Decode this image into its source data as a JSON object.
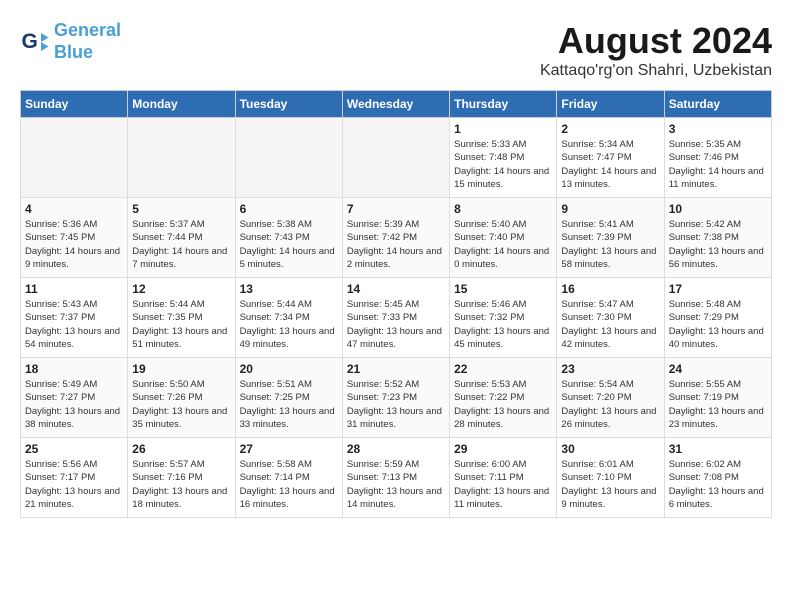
{
  "header": {
    "logo_line1": "General",
    "logo_line2": "Blue",
    "month_year": "August 2024",
    "location": "Kattaqo'rg'on Shahri, Uzbekistan"
  },
  "weekdays": [
    "Sunday",
    "Monday",
    "Tuesday",
    "Wednesday",
    "Thursday",
    "Friday",
    "Saturday"
  ],
  "weeks": [
    [
      {
        "day": "",
        "empty": true
      },
      {
        "day": "",
        "empty": true
      },
      {
        "day": "",
        "empty": true
      },
      {
        "day": "",
        "empty": true
      },
      {
        "day": "1",
        "sunrise": "5:33 AM",
        "sunset": "7:48 PM",
        "daylight": "14 hours and 15 minutes."
      },
      {
        "day": "2",
        "sunrise": "5:34 AM",
        "sunset": "7:47 PM",
        "daylight": "14 hours and 13 minutes."
      },
      {
        "day": "3",
        "sunrise": "5:35 AM",
        "sunset": "7:46 PM",
        "daylight": "14 hours and 11 minutes."
      }
    ],
    [
      {
        "day": "4",
        "sunrise": "5:36 AM",
        "sunset": "7:45 PM",
        "daylight": "14 hours and 9 minutes."
      },
      {
        "day": "5",
        "sunrise": "5:37 AM",
        "sunset": "7:44 PM",
        "daylight": "14 hours and 7 minutes."
      },
      {
        "day": "6",
        "sunrise": "5:38 AM",
        "sunset": "7:43 PM",
        "daylight": "14 hours and 5 minutes."
      },
      {
        "day": "7",
        "sunrise": "5:39 AM",
        "sunset": "7:42 PM",
        "daylight": "14 hours and 2 minutes."
      },
      {
        "day": "8",
        "sunrise": "5:40 AM",
        "sunset": "7:40 PM",
        "daylight": "14 hours and 0 minutes."
      },
      {
        "day": "9",
        "sunrise": "5:41 AM",
        "sunset": "7:39 PM",
        "daylight": "13 hours and 58 minutes."
      },
      {
        "day": "10",
        "sunrise": "5:42 AM",
        "sunset": "7:38 PM",
        "daylight": "13 hours and 56 minutes."
      }
    ],
    [
      {
        "day": "11",
        "sunrise": "5:43 AM",
        "sunset": "7:37 PM",
        "daylight": "13 hours and 54 minutes."
      },
      {
        "day": "12",
        "sunrise": "5:44 AM",
        "sunset": "7:35 PM",
        "daylight": "13 hours and 51 minutes."
      },
      {
        "day": "13",
        "sunrise": "5:44 AM",
        "sunset": "7:34 PM",
        "daylight": "13 hours and 49 minutes."
      },
      {
        "day": "14",
        "sunrise": "5:45 AM",
        "sunset": "7:33 PM",
        "daylight": "13 hours and 47 minutes."
      },
      {
        "day": "15",
        "sunrise": "5:46 AM",
        "sunset": "7:32 PM",
        "daylight": "13 hours and 45 minutes."
      },
      {
        "day": "16",
        "sunrise": "5:47 AM",
        "sunset": "7:30 PM",
        "daylight": "13 hours and 42 minutes."
      },
      {
        "day": "17",
        "sunrise": "5:48 AM",
        "sunset": "7:29 PM",
        "daylight": "13 hours and 40 minutes."
      }
    ],
    [
      {
        "day": "18",
        "sunrise": "5:49 AM",
        "sunset": "7:27 PM",
        "daylight": "13 hours and 38 minutes."
      },
      {
        "day": "19",
        "sunrise": "5:50 AM",
        "sunset": "7:26 PM",
        "daylight": "13 hours and 35 minutes."
      },
      {
        "day": "20",
        "sunrise": "5:51 AM",
        "sunset": "7:25 PM",
        "daylight": "13 hours and 33 minutes."
      },
      {
        "day": "21",
        "sunrise": "5:52 AM",
        "sunset": "7:23 PM",
        "daylight": "13 hours and 31 minutes."
      },
      {
        "day": "22",
        "sunrise": "5:53 AM",
        "sunset": "7:22 PM",
        "daylight": "13 hours and 28 minutes."
      },
      {
        "day": "23",
        "sunrise": "5:54 AM",
        "sunset": "7:20 PM",
        "daylight": "13 hours and 26 minutes."
      },
      {
        "day": "24",
        "sunrise": "5:55 AM",
        "sunset": "7:19 PM",
        "daylight": "13 hours and 23 minutes."
      }
    ],
    [
      {
        "day": "25",
        "sunrise": "5:56 AM",
        "sunset": "7:17 PM",
        "daylight": "13 hours and 21 minutes."
      },
      {
        "day": "26",
        "sunrise": "5:57 AM",
        "sunset": "7:16 PM",
        "daylight": "13 hours and 18 minutes."
      },
      {
        "day": "27",
        "sunrise": "5:58 AM",
        "sunset": "7:14 PM",
        "daylight": "13 hours and 16 minutes."
      },
      {
        "day": "28",
        "sunrise": "5:59 AM",
        "sunset": "7:13 PM",
        "daylight": "13 hours and 14 minutes."
      },
      {
        "day": "29",
        "sunrise": "6:00 AM",
        "sunset": "7:11 PM",
        "daylight": "13 hours and 11 minutes."
      },
      {
        "day": "30",
        "sunrise": "6:01 AM",
        "sunset": "7:10 PM",
        "daylight": "13 hours and 9 minutes."
      },
      {
        "day": "31",
        "sunrise": "6:02 AM",
        "sunset": "7:08 PM",
        "daylight": "13 hours and 6 minutes."
      }
    ]
  ]
}
